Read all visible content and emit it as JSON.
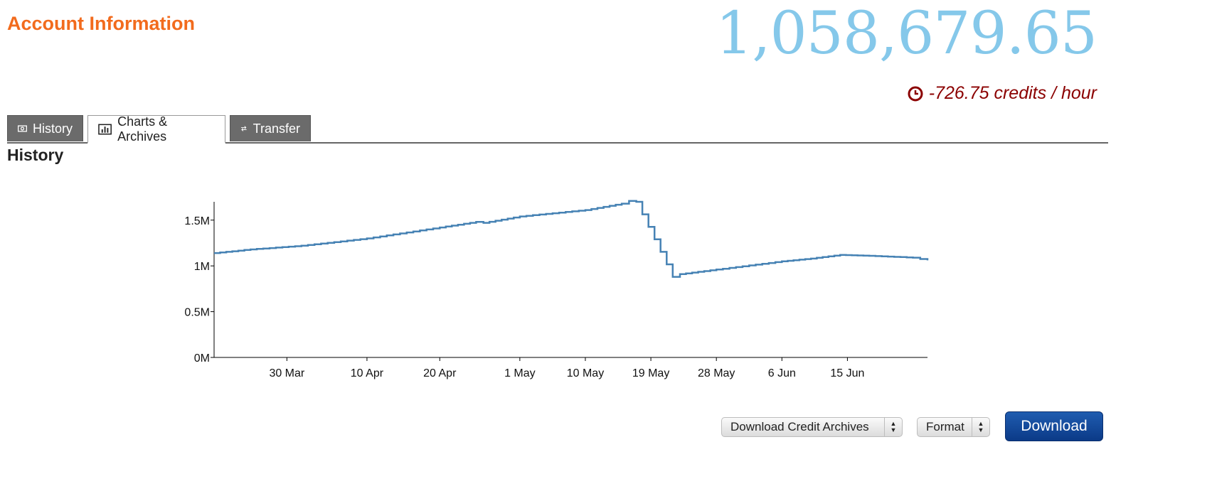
{
  "header": {
    "title": "Account Information",
    "balance": "1,058,679.65",
    "rate": "-726.75 credits / hour",
    "rate_icon": "clock-icon"
  },
  "tabs": [
    {
      "label": "History",
      "icon": "money-icon",
      "active": false
    },
    {
      "label": "Charts & Archives",
      "icon": "bar-chart-icon",
      "active": true
    },
    {
      "label": "Transfer",
      "icon": "transfer-icon",
      "active": false
    }
  ],
  "section": {
    "title": "History"
  },
  "colors": {
    "title": "#f26b1d",
    "balance": "#85c8ea",
    "rate": "#8b0000",
    "line": "#4682b4",
    "download": "#0b3a87"
  },
  "chart_data": {
    "type": "line",
    "title": "",
    "xlabel": "",
    "ylabel": "",
    "x_ticks": [
      "30 Mar",
      "10 Apr",
      "20 Apr",
      "1 May",
      "10 May",
      "19 May",
      "28 May",
      "6 Jun",
      "15 Jun"
    ],
    "y_ticks": [
      "0M",
      "0.5M",
      "1M",
      "1.5M"
    ],
    "ylim": [
      0,
      1700000
    ],
    "xlim": [
      "2013-03-20",
      "2013-06-26"
    ],
    "grid": false,
    "series": [
      {
        "x": [
          "2013-03-20",
          "2013-03-25",
          "2013-04-01",
          "2013-04-10",
          "2013-04-20",
          "2013-04-25",
          "2013-04-26",
          "2013-05-01",
          "2013-05-10",
          "2013-05-15",
          "2013-05-16",
          "2013-05-17",
          "2013-05-22",
          "2013-05-23",
          "2013-05-28",
          "2013-06-06",
          "2013-06-10",
          "2013-06-14",
          "2013-06-18",
          "2013-06-24",
          "2013-06-26"
        ],
        "y": [
          1140000,
          1180000,
          1220000,
          1300000,
          1420000,
          1480000,
          1470000,
          1540000,
          1610000,
          1680000,
          1710000,
          1700000,
          880000,
          910000,
          960000,
          1050000,
          1080000,
          1120000,
          1110000,
          1090000,
          1060000
        ]
      }
    ]
  },
  "controls": {
    "archive_select": "Download Credit Archives",
    "format_select": "Format",
    "download_button": "Download"
  }
}
